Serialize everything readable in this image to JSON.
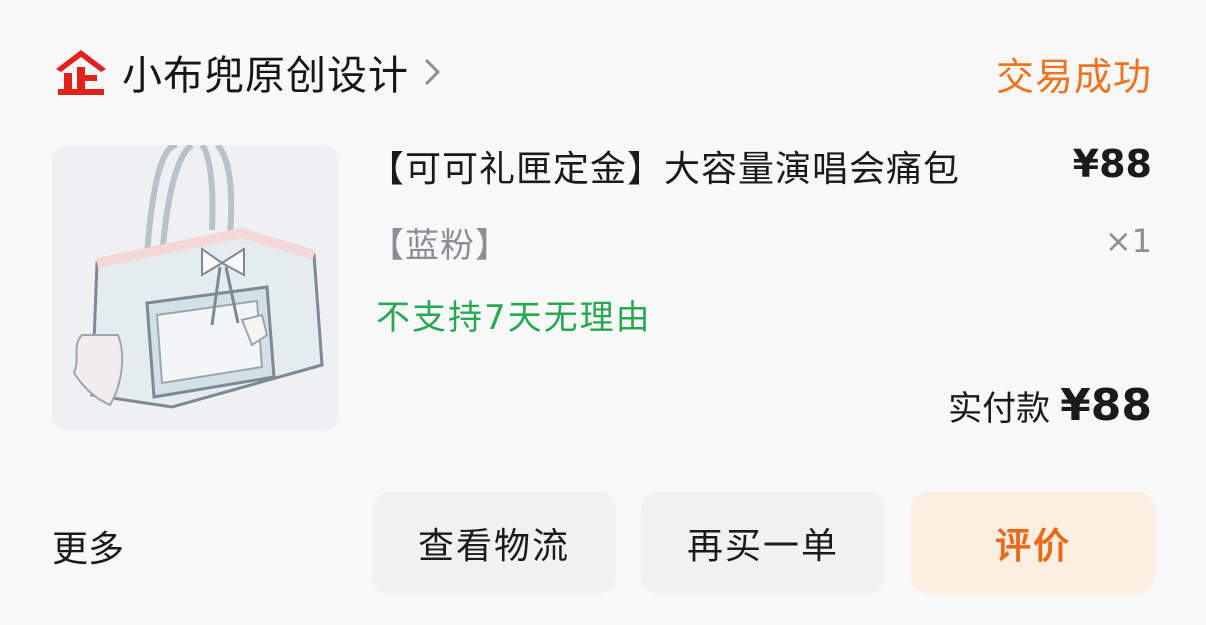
{
  "header": {
    "shop_badge_icon": "tmall-enterprise-icon",
    "shop_name": "小布兜原创设计",
    "chevron_icon": "chevron-right-icon",
    "order_status": "交易成功"
  },
  "product": {
    "image_icon": "handbag-product-image",
    "title": "【可可礼匣定金】大容量演唱会痛包",
    "price": "¥88",
    "spec": "【蓝粉】",
    "quantity": "×1",
    "tag": "不支持7天无理由"
  },
  "payment": {
    "label": "实付款",
    "amount": "¥88"
  },
  "actions": {
    "more": "更多",
    "logistics": "查看物流",
    "rebuy": "再买一单",
    "review": "评价"
  },
  "colors": {
    "status_orange": "#ee7420",
    "tag_green": "#29a853",
    "badge_red": "#e0221b",
    "review_bg": "#fdeee2"
  }
}
